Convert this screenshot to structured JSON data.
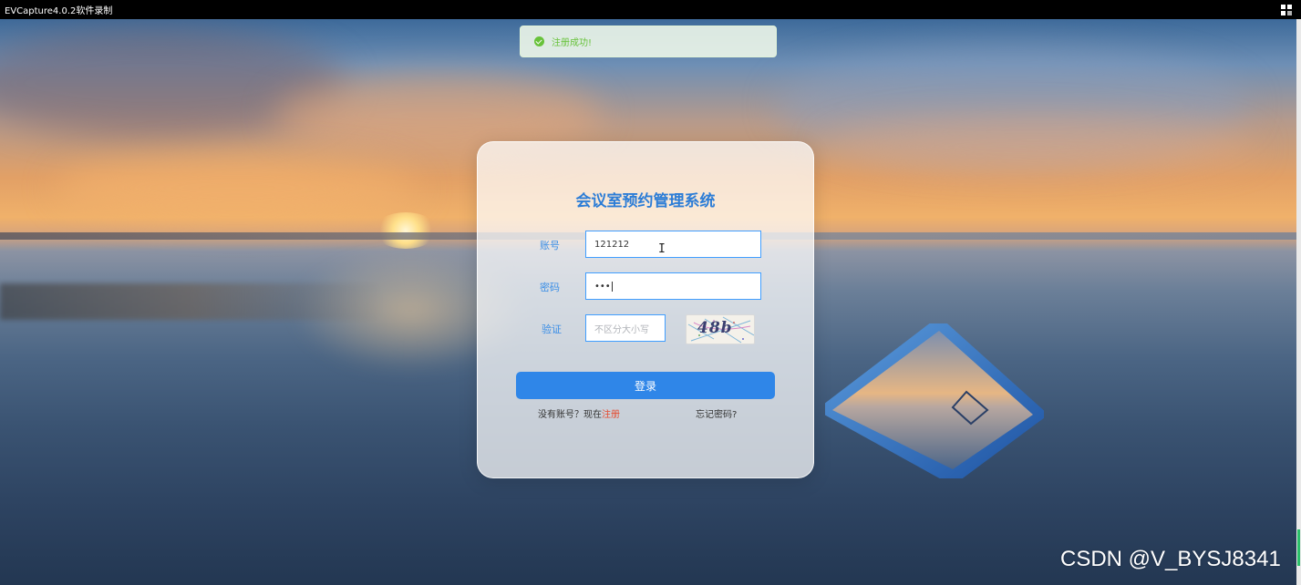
{
  "window": {
    "title": "EVCapture4.0.2软件录制"
  },
  "toast": {
    "message": "注册成功!"
  },
  "login": {
    "title": "会议室预约管理系统",
    "account_label": "账号",
    "account_value": "121212",
    "password_label": "密码",
    "password_value": "•••",
    "captcha_label": "验证",
    "captcha_placeholder": "不区分大小写",
    "captcha_text": "48b",
    "login_button": "登录",
    "no_account_text": "没有账号？现在",
    "register_link": "注册",
    "forgot_password": "忘记密码?"
  },
  "watermark": {
    "text": "CSDN @V_BYSJ8341"
  },
  "colors": {
    "accent": "#2f86e8",
    "title": "#2d7dd6",
    "success": "#67c23a",
    "link": "#e6492d"
  }
}
